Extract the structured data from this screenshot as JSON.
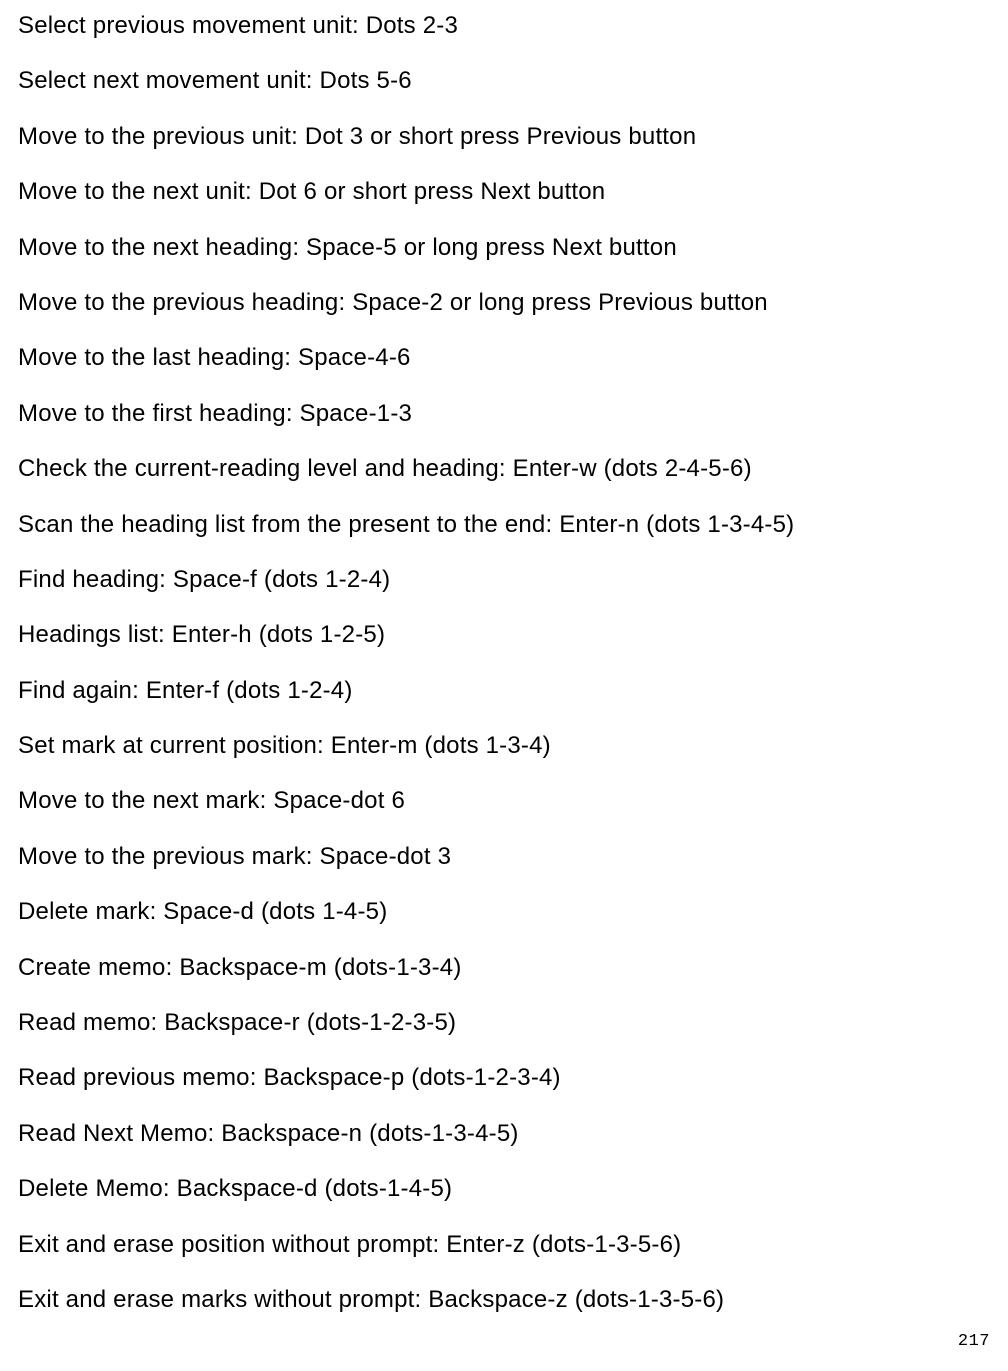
{
  "lines": [
    "Select previous movement unit: Dots 2-3",
    "Select next movement unit: Dots 5-6",
    "Move to the previous unit: Dot 3 or short press Previous button",
    "Move to the next unit: Dot 6 or short press Next button",
    "Move to the next heading: Space-5 or long press Next button",
    "Move to the previous heading: Space-2 or long press Previous button",
    "Move to the last heading: Space-4-6",
    "Move to the first heading: Space-1-3",
    "Check the current-reading level and heading: Enter-w (dots 2-4-5-6)",
    "Scan the heading list from the present to the end: Enter-n (dots 1-3-4-5)",
    "Find heading: Space-f (dots 1-2-4)",
    "Headings list: Enter-h (dots 1-2-5)",
    "Find again: Enter-f (dots 1-2-4)",
    "Set mark at current position: Enter-m (dots 1-3-4)",
    "Move to the next mark: Space-dot 6",
    "Move to the previous mark: Space-dot 3",
    "Delete mark: Space-d (dots 1-4-5)",
    "Create memo: Backspace-m (dots-1-3-4)",
    "Read memo: Backspace-r (dots-1-2-3-5)",
    "Read previous memo: Backspace-p (dots-1-2-3-4)",
    "Read Next Memo: Backspace-n (dots-1-3-4-5)",
    "Delete Memo: Backspace-d (dots-1-4-5)",
    "Exit and erase position without prompt: Enter-z (dots-1-3-5-6)",
    "Exit and erase marks without prompt: Backspace-z (dots-1-3-5-6)"
  ],
  "page_number": "217"
}
